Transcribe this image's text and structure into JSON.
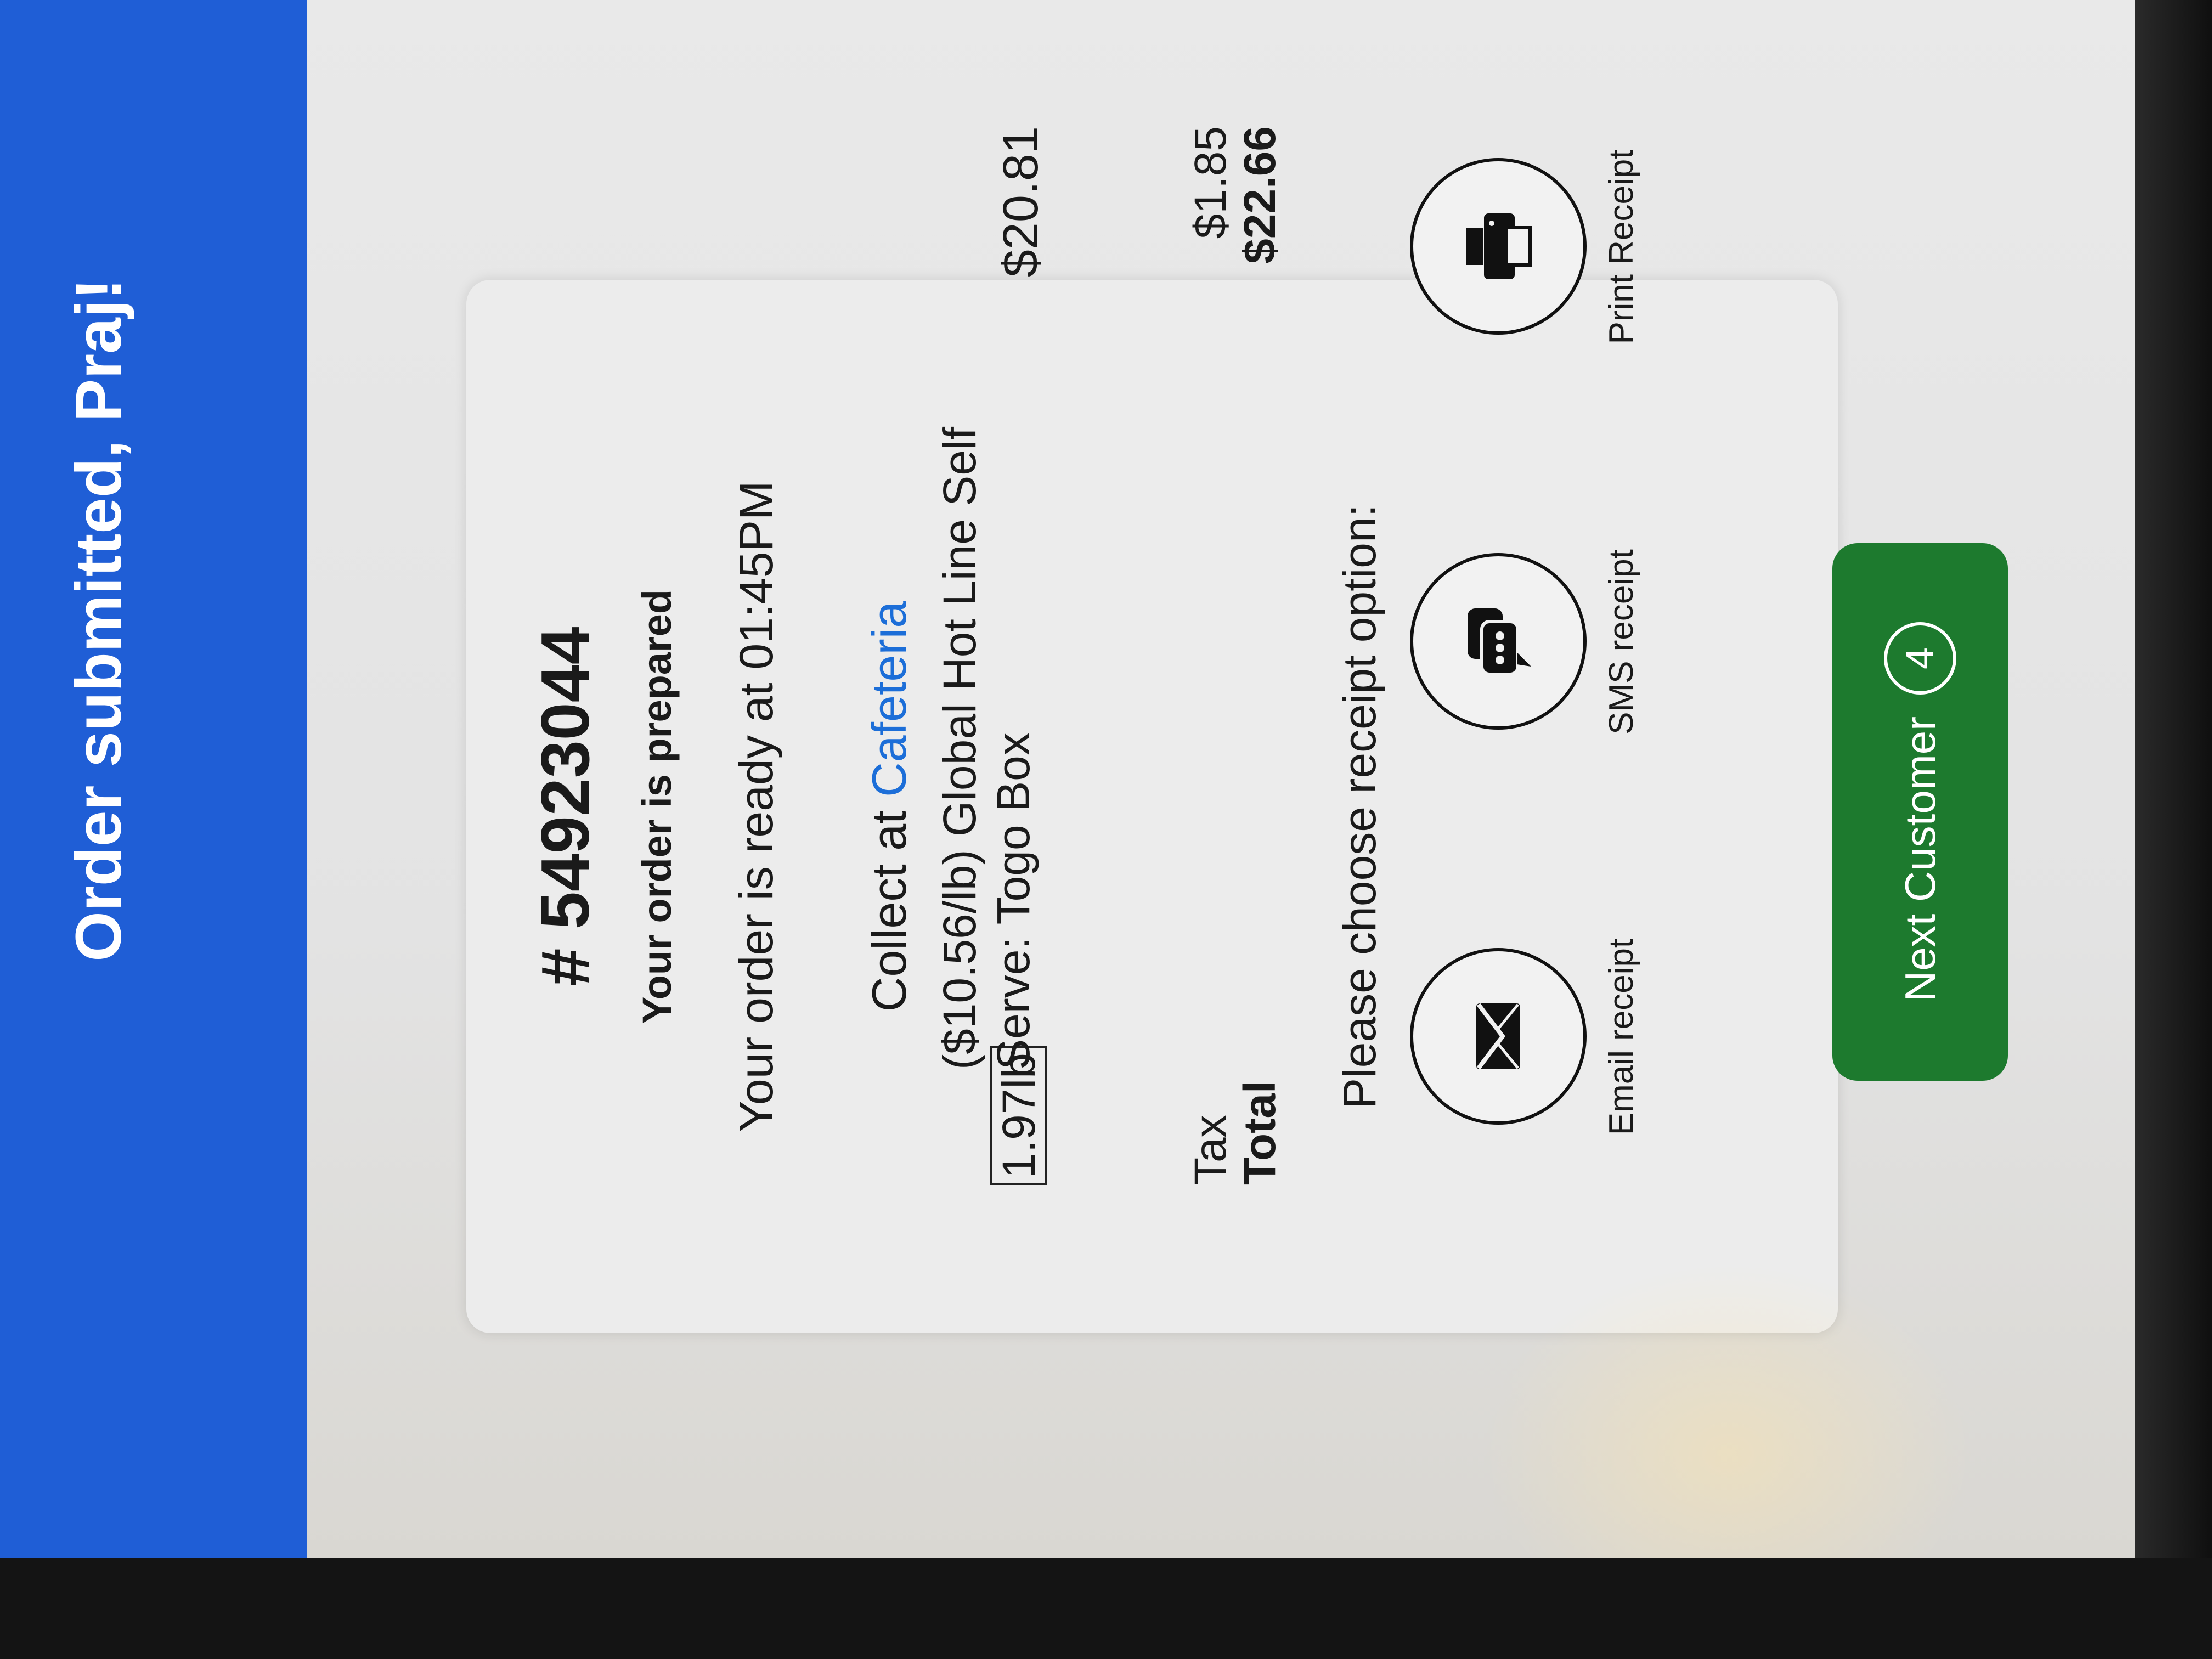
{
  "header": {
    "title": "Order submitted, Praj!"
  },
  "order": {
    "number": "# 54923044",
    "status": "Your order is prepared",
    "ready_text": "Your order is ready at 01:45PM",
    "collect_prefix": "Collect at",
    "collect_location": "Cafeteria"
  },
  "line_items": [
    {
      "quantity": "1.97lb",
      "description": "($10.56/lb) Global Hot Line Self Serve: Togo Box",
      "price": "$20.81"
    }
  ],
  "summary": {
    "tax_label": "Tax",
    "tax_value": "$1.85",
    "total_label": "Total",
    "total_value": "$22.66"
  },
  "receipt": {
    "prompt": "Please choose receipt option:",
    "options": [
      {
        "label": "Email receipt",
        "icon": "envelope-icon"
      },
      {
        "label": "SMS receipt",
        "icon": "chat-bubbles-icon"
      },
      {
        "label": "Print Receipt",
        "icon": "printer-icon"
      }
    ]
  },
  "next_button": {
    "label": "Next Customer",
    "count": "4"
  },
  "colors": {
    "banner": "#1f5ed6",
    "accent_link": "#1c6ed8",
    "next_button": "#1d7a2e"
  }
}
